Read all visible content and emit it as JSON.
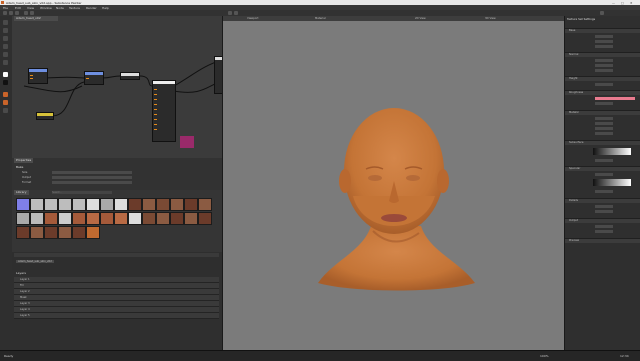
{
  "window": {
    "title": "Adam_head_sub_skin_v02.spp - Substance Painter",
    "controls": [
      "—",
      "□",
      "✕"
    ]
  },
  "menu": [
    "File",
    "Edit",
    "View",
    "Window",
    "Node",
    "Texture",
    "Render",
    "Help"
  ],
  "tabs": {
    "graph": "Adam_head_v02",
    "viewport": [
      "Viewport",
      "Material",
      "2D View",
      "3D View"
    ],
    "properties": "Properties",
    "library": "Library",
    "right": "Texture Set Settings"
  },
  "props": {
    "title": "Bake",
    "rows": [
      "Size",
      "Output",
      "Format"
    ]
  },
  "library": {
    "title": "Shelf",
    "search_placeholder": "Search..."
  },
  "status_panel": {
    "label": "Adam_head_sub_skin_v02"
  },
  "bottom": {
    "title": "Layers",
    "rows": [
      "Layer 1",
      "Fill",
      "Layer 2",
      "Mask",
      "Layer 3",
      "Layer 4",
      "Layer 5"
    ]
  },
  "right_panel": {
    "sections": [
      "Base",
      "Normal",
      "Height",
      "Roughness",
      "Metallic",
      "Subsurface",
      "Specular",
      "Details",
      "Output",
      "Preview"
    ],
    "accent_color": "#e87b8f"
  },
  "statusbar": {
    "left": "Ready",
    "zoom": "100%",
    "time": "12:34"
  },
  "colors": {
    "viewport_bg": "#7b7b7b",
    "skin": "#c9783d",
    "node_accent_blue": "#6e8fe0",
    "node_accent_yellow": "#d7c23a",
    "panel": "#2f2f2f"
  }
}
